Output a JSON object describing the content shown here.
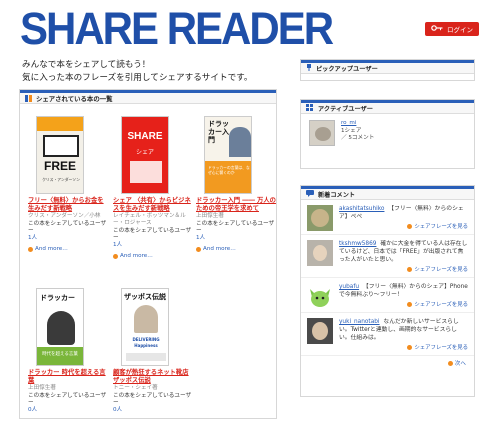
{
  "header": {
    "logo": "SHARE READER",
    "tagline_1": "みんなで本をシェアして読もう！",
    "tagline_2": "気に入った本のフレーズを引用してシェアするサイトです。",
    "login_label": "ログイン",
    "login_icon": "key-icon"
  },
  "main": {
    "heading": "シェアされている本の一覧",
    "books": [
      {
        "cover_text": "FREE",
        "cover_sub": "クリス・アンダーソン",
        "title": "フリー〈無料〉からお金を生みだす新戦略",
        "author": "クリス・アンダーソン／小林",
        "share_text": "この本をシェアしているユーザー",
        "count": "1人",
        "more": "And more…"
      },
      {
        "cover_text": "SHARE",
        "cover_sub": "シェア",
        "title": "シェア 〈共有〉からビジネスを生みだす新戦略",
        "author": "レイチェル・ボッツマン＆ルー・ロジャース",
        "share_text": "この本をシェアしているユーザー",
        "count": "1人",
        "more": "And more…"
      },
      {
        "cover_text": "ドラッカー入門",
        "cover_sub": "ドラッカーの言葉は、なぜ心に響くのか",
        "title": "ドラッカー入門 ―― 万人のための帝王学を求めて",
        "author": "上田惇生著",
        "share_text": "この本をシェアしているユーザー",
        "count": "1人",
        "more": "And more…"
      },
      {
        "cover_text": "ドラッカー",
        "cover_sub": "時代を超える言葉",
        "title": "ドラッカー 時代を超える言葉",
        "author": "上田惇生著",
        "share_text": "この本をシェアしているユーザー",
        "count": "0人",
        "more": ""
      },
      {
        "cover_text": "ザッポス伝説",
        "cover_sub": "DELIVERING Happiness",
        "title": "顧客が熱狂するネット靴店 ザッポス伝説",
        "author": "トニー・シェイ著",
        "share_text": "この本をシェアしているユーザー",
        "count": "0人",
        "more": ""
      }
    ]
  },
  "pickup": {
    "heading": "ピックアップユーザー"
  },
  "active": {
    "heading": "アクティブユーザー",
    "user": "ro_mi",
    "shares": "1シェア",
    "comments": "／ 5コメント"
  },
  "comments": {
    "heading": "新着コメント",
    "items": [
      {
        "user": "akashitatsuhiko",
        "text": "【フリー〈無料〉からのシェア】ぺぺ",
        "link": "シェアフレーズを見る"
      },
      {
        "user": "tkshmw5869",
        "text": "確かに大金を得ている人は存在しているけど、日本では「FREE」が出版されて焦った人がいたと思い。",
        "link": "シェアフレーズを見る"
      },
      {
        "user": "yubafu",
        "text": "【フリー〈無料〉からのシェア】Phoneで今無料ぶり〜フリー！",
        "link": "シェアフレーズを見る"
      },
      {
        "user": "yuki_nanotabi",
        "text": "なんだか新しいサービスらしい。Twitterと連動し、画期的なサービスらしい。仕組みは。",
        "link": "シェアフレーズを見る"
      }
    ],
    "next": "次へ"
  },
  "colors": {
    "brand_blue": "#1f4fa8",
    "accent_red": "#d9241b",
    "link_orange": "#f28c1e"
  }
}
